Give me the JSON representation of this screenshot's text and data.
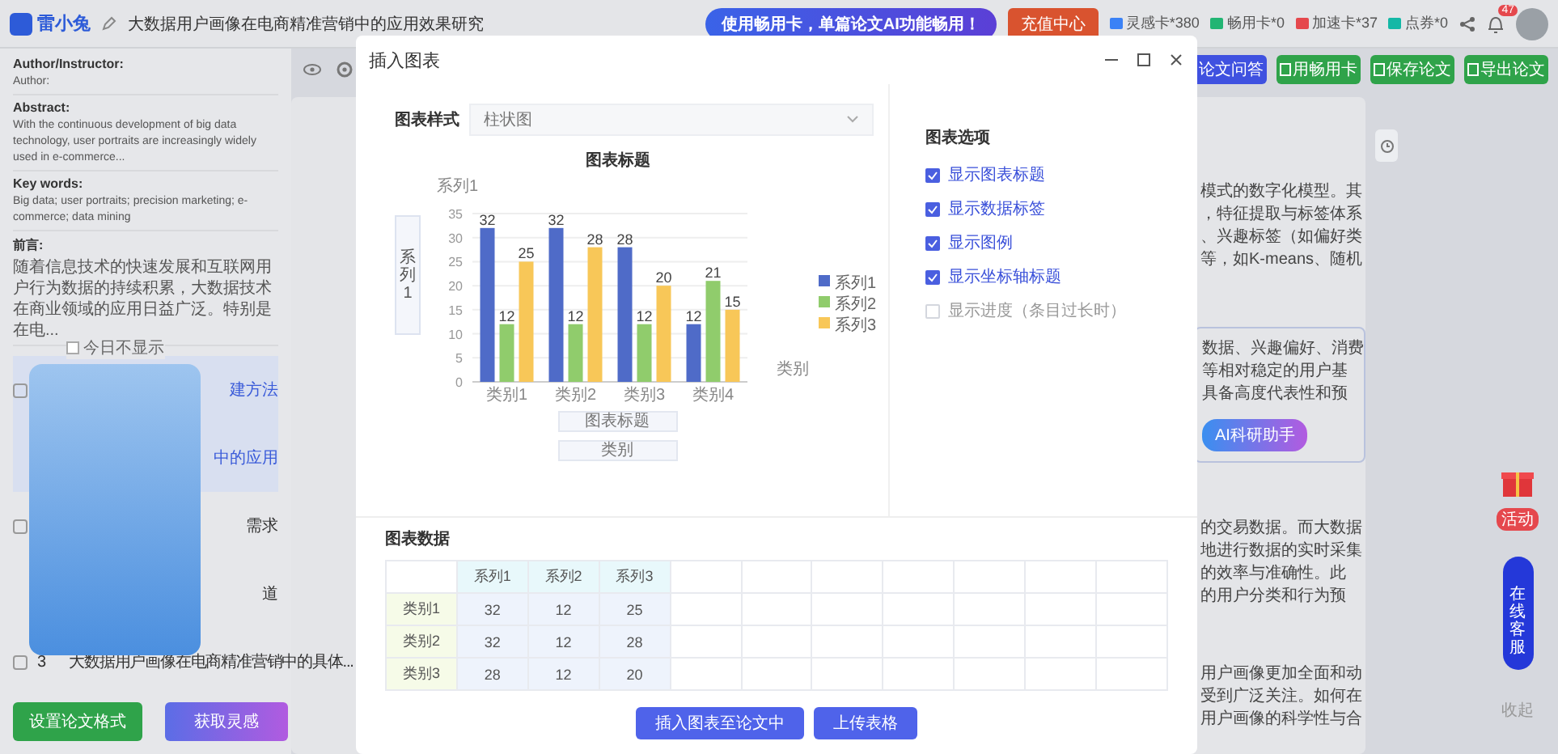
{
  "top_bar": {
    "logo": "雷小兔",
    "doc_title": "大数据用户画像在电商精准营销中的应用效果研究",
    "promo_banner": "使用畅用卡，单篇论文AI功能畅用！",
    "recharge_button": "充值中心",
    "cards": [
      {
        "label": "灵感卡*380",
        "color": "#3b82f6"
      },
      {
        "label": "畅用卡*0",
        "color": "#22b573"
      },
      {
        "label": "加速卡*37",
        "color": "#e5484d"
      },
      {
        "label": "点券*0",
        "color": "#14b8a6"
      }
    ],
    "notification_count": "47"
  },
  "toolbar": {
    "buttons": [
      {
        "label": "论文问答",
        "kind": "primary"
      },
      {
        "label": "用畅用卡",
        "kind": "success"
      },
      {
        "label": "保存论文",
        "kind": "success"
      },
      {
        "label": "导出论文",
        "kind": "success"
      }
    ]
  },
  "left_panel": {
    "sections": [
      {
        "heading": "Author/Instructor:",
        "text": "Author:"
      },
      {
        "heading": "Abstract:",
        "text": "With the continuous development of big data technology, user portraits are increasingly widely used in e-commerce..."
      },
      {
        "heading": "Key words:",
        "text": "Big data; user portraits; precision marketing; e-commerce; data mining"
      },
      {
        "heading": "前言:",
        "text": "随着信息技术的快速发展和互联网用户行为数据的持续积累，大数据技术在商业领域的应用日益广泛。特别是在电..."
      }
    ],
    "outline": [
      {
        "title": "建方法",
        "highlighted": true,
        "expandable": true
      },
      {
        "title": "中的应用",
        "highlighted": true,
        "expandable": false
      },
      {
        "title": "需求",
        "highlighted": false,
        "expandable": true
      },
      {
        "title": "道",
        "highlighted": false,
        "expandable": false
      },
      {
        "number": "3",
        "title": "大数据用户画像在电商精准营销中的具体...",
        "highlighted": false,
        "expandable": true
      }
    ],
    "format_button": "设置论文格式",
    "inspiration_button": "获取灵感"
  },
  "popup": {
    "dont_show_today": {
      "label": "今日不显示",
      "checked": false
    }
  },
  "document": {
    "paragraphs": [
      {
        "boxed": false,
        "lines": [
          "模式的数字化模型。其",
          "，特征提取与标签体系",
          "、兴趣标签（如偏好类",
          "等，如K-means、随机"
        ]
      },
      {
        "boxed": true,
        "lines": [
          "数据、兴趣偏好、消费",
          "等相对稳定的用户基",
          "具备高度代表性和预"
        ]
      },
      {
        "boxed": false,
        "lines": [
          "的交易数据。而大数据",
          "地进行数据的实时采集",
          "的效率与准确性。此",
          "的用户分类和行为预"
        ]
      },
      {
        "boxed": false,
        "lines": [
          "用户画像更加全面和动",
          "受到广泛关注。如何在",
          "用户画像的科学性与合"
        ]
      }
    ],
    "ai_assistant_button": "AI科研助手"
  },
  "side_float": {
    "gift_label": "活动",
    "service_button": "在线客服",
    "collapse": "收起"
  },
  "dialog": {
    "title": "插入图表",
    "chart_style": {
      "label": "图表样式",
      "value": "柱状图"
    },
    "y_axis_title_field": {
      "value": "系列1"
    },
    "chart_title_field": {
      "value": "图表标题"
    },
    "x_axis_title_field": {
      "value": "类别"
    },
    "chart_data": {
      "type": "bar",
      "title": "图表标题",
      "xlabel": "类别",
      "ylabel": "系列1",
      "categories": [
        "类别1",
        "类别2",
        "类别3",
        "类别4"
      ],
      "series": [
        {
          "name": "系列1",
          "color": "#4f6bc8",
          "values": [
            32,
            32,
            28,
            12
          ]
        },
        {
          "name": "系列2",
          "color": "#90cc6c",
          "values": [
            12,
            12,
            12,
            21
          ]
        },
        {
          "name": "系列3",
          "color": "#f8c758",
          "values": [
            25,
            28,
            20,
            15
          ]
        }
      ],
      "ylim": [
        0,
        35
      ],
      "grid": true,
      "legend": true,
      "yticks": [
        0,
        5,
        10,
        15,
        20,
        25,
        30,
        35
      ],
      "data_labels": true
    },
    "options": {
      "heading": "图表选项",
      "items": [
        {
          "label": "显示图表标题",
          "checked": true
        },
        {
          "label": "显示数据标签",
          "checked": true
        },
        {
          "label": "显示图例",
          "checked": true
        },
        {
          "label": "显示坐标轴标题",
          "checked": true
        },
        {
          "label": "显示进度（条目过长时）",
          "checked": false
        }
      ]
    },
    "table": {
      "heading": "图表数据",
      "columns": [
        "系列1",
        "系列2",
        "系列3"
      ],
      "rows": [
        {
          "label": "类别1",
          "cells": [
            "32",
            "12",
            "25"
          ]
        },
        {
          "label": "类别2",
          "cells": [
            "32",
            "12",
            "28"
          ]
        },
        {
          "label": "类别3",
          "cells": [
            "28",
            "12",
            "20"
          ]
        }
      ]
    },
    "buttons": [
      "插入图表至论文中",
      "上传表格"
    ]
  }
}
